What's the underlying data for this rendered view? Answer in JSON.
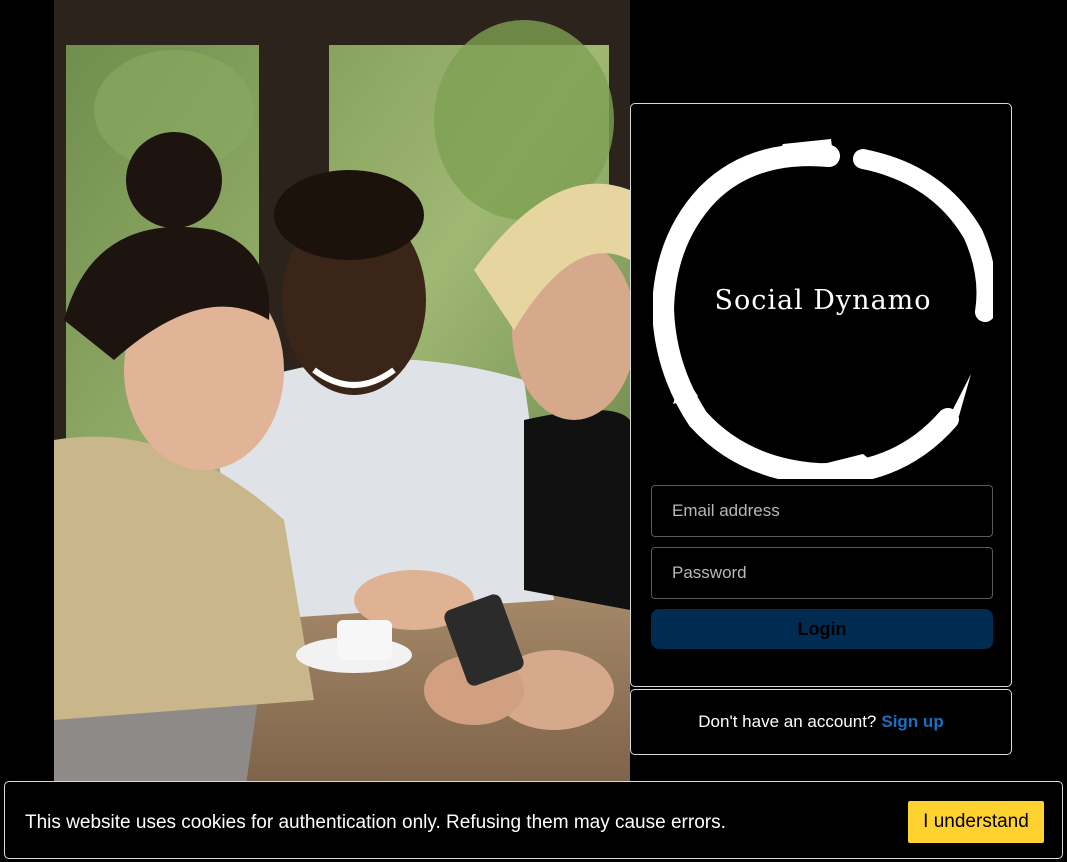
{
  "brand": {
    "name": "Social Dynamo"
  },
  "login": {
    "email_placeholder": "Email address",
    "password_placeholder": "Password",
    "login_label": "Login"
  },
  "signup": {
    "prompt": "Don't have an account?",
    "link_label": "Sign up"
  },
  "cookie_banner": {
    "message": "This website uses cookies for authentication only. Refusing them may cause errors.",
    "accept_label": "I understand"
  },
  "colors": {
    "background": "#000000",
    "login_button": "#012c52",
    "link": "#1b6ec2",
    "cookie_button": "#ffd230"
  }
}
